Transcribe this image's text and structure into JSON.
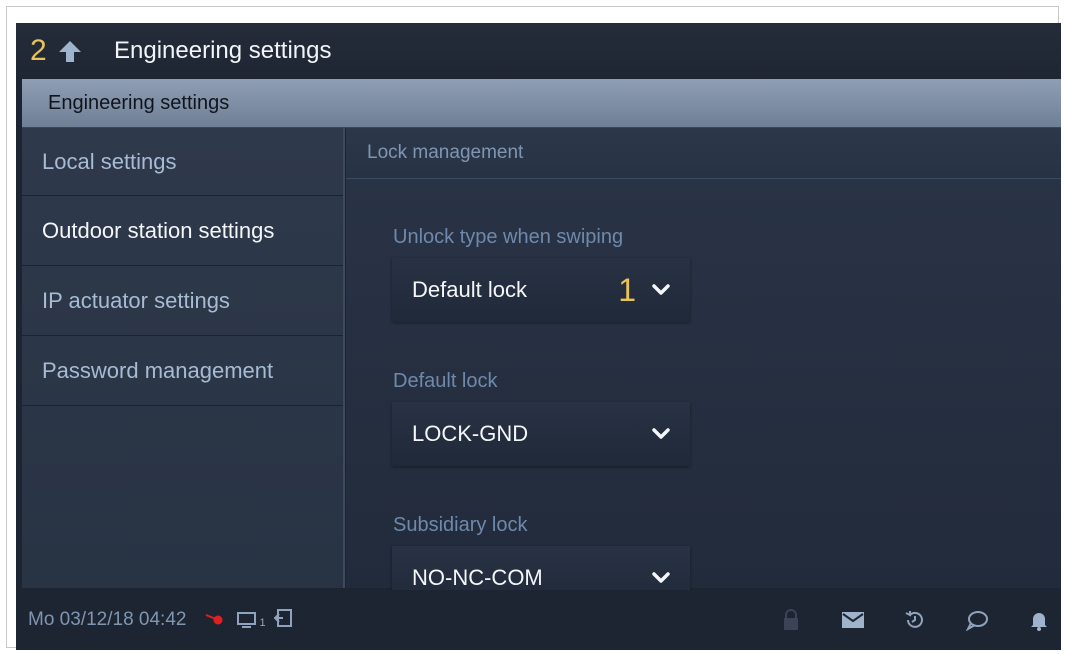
{
  "topbar": {
    "step_number": "2",
    "title": "Engineering settings"
  },
  "subheader": {
    "title": "Engineering settings"
  },
  "sidebar": {
    "items": [
      {
        "label": "Local settings",
        "active": false
      },
      {
        "label": "Outdoor station settings",
        "active": true
      },
      {
        "label": "IP actuator settings",
        "active": false
      },
      {
        "label": "Password management",
        "active": false
      }
    ]
  },
  "main": {
    "panel_title": "Lock management",
    "fields": [
      {
        "label": "Unlock type when swiping",
        "value": "Default lock",
        "marker": "1"
      },
      {
        "label": "Default lock",
        "value": "LOCK-GND"
      },
      {
        "label": "Subsidiary lock",
        "value": "NO-NC-COM"
      }
    ]
  },
  "statusbar": {
    "datetime": "Mo 03/12/18  04:42",
    "monitor_subscript": "1",
    "icons": [
      "bell-slash-icon",
      "monitor-icon",
      "exit-door-icon",
      "lock-icon",
      "mail-icon",
      "history-icon",
      "chat-icon",
      "bell-icon"
    ]
  },
  "colors": {
    "accent_yellow": "#e8c35a",
    "background": "#1d2533",
    "label_blue": "#6f89ab",
    "alert_red": "#e0201e"
  }
}
